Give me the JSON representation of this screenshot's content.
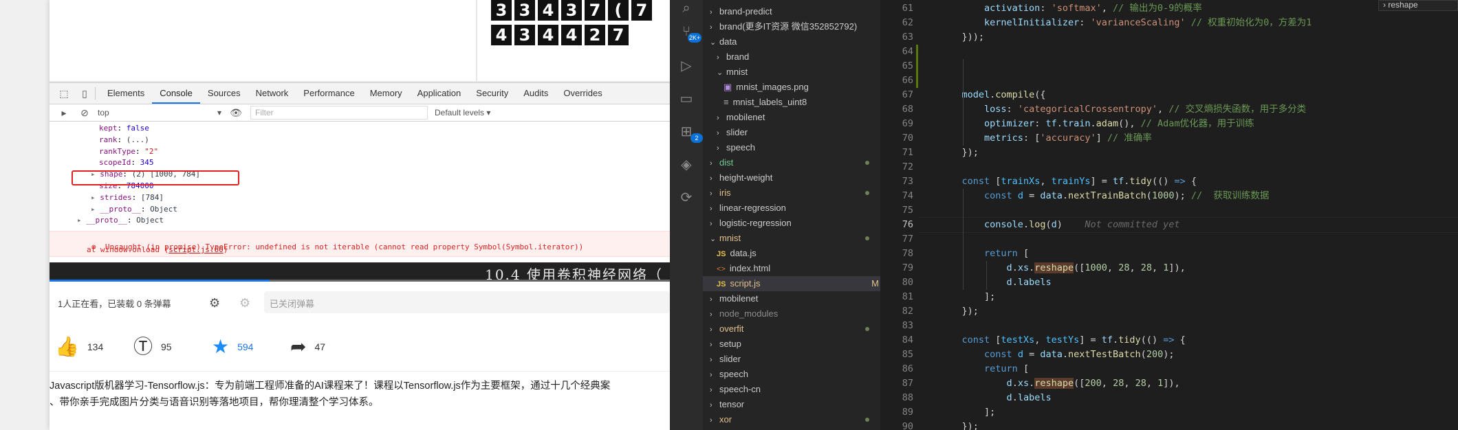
{
  "devtools": {
    "tabs": [
      "Elements",
      "Console",
      "Sources",
      "Network",
      "Performance",
      "Memory",
      "Application",
      "Security",
      "Audits",
      "Overrides"
    ],
    "active_tab": "Console",
    "context": "top",
    "filter_placeholder": "Filter",
    "levels": "Default levels ▾",
    "console_lines": [
      {
        "key": "kept",
        "value": "false",
        "kind": "num"
      },
      {
        "key": "rank",
        "value": "(...)",
        "kind": "obj"
      },
      {
        "key": "rankType",
        "value": "\"2\"",
        "kind": "str"
      },
      {
        "key": "scopeId",
        "value": "345",
        "kind": "num"
      },
      {
        "key": "shape",
        "value": "(2) [1000, 784]",
        "kind": "obj"
      },
      {
        "key": "size",
        "value": "784000",
        "kind": "num"
      },
      {
        "key": "strides",
        "value": "[784]",
        "kind": "obj"
      },
      {
        "key": "__proto__",
        "value": "Object",
        "kind": "obj"
      },
      {
        "key": "__proto__",
        "value": "Object",
        "kind": "obj"
      }
    ],
    "error_line1": "Uncaught (in promise) TypeError: undefined is not iterable (cannot read property Symbol(Symbol.iterator))",
    "error_line2_prefix": "at window.onload (",
    "error_link": "script.js:60",
    "error_line2_suffix": ")"
  },
  "video": {
    "title": "10.4 使用卷积神经网络（",
    "watching": "1人正在看，已装载 0 条弹幕",
    "danmaku_placeholder": "已关闭弹幕"
  },
  "actions": {
    "like": "134",
    "coin": "95",
    "favorite": "594",
    "share": "47"
  },
  "description": {
    "line1": "Javascript版机器学习-Tensorflow.js：专为前端工程师准备的AI课程来了！课程以Tensorflow.js作为主要框架，通过十几个经典案",
    "line2": "、带你亲手完成图片分类与语音识别等落地项目，帮你理清整个学习体系。"
  },
  "activity_badges": {
    "source_control": "2K+",
    "extensions": "2"
  },
  "explorer": {
    "items": [
      {
        "label": "brand-predict",
        "indent": 1,
        "open": false,
        "color": "#cccccc"
      },
      {
        "label": "brand(更多IT资源 微信352852792)",
        "indent": 1,
        "open": false,
        "color": "#cccccc"
      },
      {
        "label": "data",
        "indent": 1,
        "open": true,
        "color": "#cccccc"
      },
      {
        "label": "brand",
        "indent": 2,
        "open": false,
        "color": "#cccccc"
      },
      {
        "label": "mnist",
        "indent": 2,
        "open": true,
        "color": "#cccccc"
      },
      {
        "label": "mnist_images.png",
        "indent": 3,
        "file": "img",
        "color": "#cccccc"
      },
      {
        "label": "mnist_labels_uint8",
        "indent": 3,
        "file": "txt",
        "color": "#cccccc"
      },
      {
        "label": "mobilenet",
        "indent": 2,
        "open": false,
        "color": "#cccccc"
      },
      {
        "label": "slider",
        "indent": 2,
        "open": false,
        "color": "#cccccc"
      },
      {
        "label": "speech",
        "indent": 2,
        "open": false,
        "color": "#cccccc"
      },
      {
        "label": "dist",
        "indent": 1,
        "open": false,
        "color": "#73c991",
        "dot": true
      },
      {
        "label": "height-weight",
        "indent": 1,
        "open": false,
        "color": "#cccccc"
      },
      {
        "label": "iris",
        "indent": 1,
        "open": false,
        "color": "#e2c08d",
        "dot": true
      },
      {
        "label": "linear-regression",
        "indent": 1,
        "open": false,
        "color": "#cccccc"
      },
      {
        "label": "logistic-regression",
        "indent": 1,
        "open": false,
        "color": "#cccccc"
      },
      {
        "label": "mnist",
        "indent": 1,
        "open": true,
        "color": "#e2c08d",
        "dot": true
      },
      {
        "label": "data.js",
        "indent": 2,
        "file": "js",
        "color": "#cccccc"
      },
      {
        "label": "index.html",
        "indent": 2,
        "file": "html",
        "color": "#cccccc"
      },
      {
        "label": "script.js",
        "indent": 2,
        "file": "js",
        "color": "#e2c08d",
        "badge": "M",
        "selected": true
      },
      {
        "label": "mobilenet",
        "indent": 1,
        "open": false,
        "color": "#cccccc"
      },
      {
        "label": "node_modules",
        "indent": 1,
        "open": false,
        "color": "#8b8b8b"
      },
      {
        "label": "overfit",
        "indent": 1,
        "open": false,
        "color": "#e2c08d",
        "dot": true
      },
      {
        "label": "setup",
        "indent": 1,
        "open": false,
        "color": "#cccccc"
      },
      {
        "label": "slider",
        "indent": 1,
        "open": false,
        "color": "#cccccc"
      },
      {
        "label": "speech",
        "indent": 1,
        "open": false,
        "color": "#cccccc"
      },
      {
        "label": "speech-cn",
        "indent": 1,
        "open": false,
        "color": "#cccccc"
      },
      {
        "label": "tensor",
        "indent": 1,
        "open": false,
        "color": "#cccccc"
      },
      {
        "label": "xor",
        "indent": 1,
        "open": false,
        "color": "#e2c08d",
        "dot": true
      }
    ]
  },
  "editor": {
    "current_line": 76,
    "ghost_text": "Not committed yet",
    "breadcrumb_tag": "reshape",
    "lines": [
      {
        "n": 61,
        "html": "        <span class='c-prop'>activation</span>: <span class='c-str'>'softmax'</span>, <span class='c-cm'>// 输出为0-9的概率</span>"
      },
      {
        "n": 62,
        "html": "        <span class='c-prop'>kernelInitializer</span>: <span class='c-str'>'varianceScaling'</span> <span class='c-cm'>// 权重初始化为0，方差为1</span>"
      },
      {
        "n": 63,
        "html": "    }));"
      },
      {
        "n": 64,
        "html": ""
      },
      {
        "n": 65,
        "html": ""
      },
      {
        "n": 66,
        "html": ""
      },
      {
        "n": 67,
        "html": "    <span class='c-prop'>model</span>.<span class='c-fn'>compile</span>({"
      },
      {
        "n": 68,
        "html": "        <span class='c-prop'>loss</span>: <span class='c-str'>'categoricalCrossentropy'</span>, <span class='c-cm'>// 交叉熵损失函数，用于多分类</span>"
      },
      {
        "n": 69,
        "html": "        <span class='c-prop'>optimizer</span>: <span class='c-prop'>tf</span>.<span class='c-prop'>train</span>.<span class='c-fn'>adam</span>(), <span class='c-cm'>// Adam优化器，用于训练</span>"
      },
      {
        "n": 70,
        "html": "        <span class='c-prop'>metrics</span>: [<span class='c-str'>'accuracy'</span>] <span class='c-cm'>// 准确率</span>"
      },
      {
        "n": 71,
        "html": "    });"
      },
      {
        "n": 72,
        "html": ""
      },
      {
        "n": 73,
        "html": "    <span class='c-kw'>const</span> [<span class='c-var'>trainXs</span>, <span class='c-var'>trainYs</span>] = <span class='c-prop'>tf</span>.<span class='c-fn'>tidy</span>(() <span class='c-kw'>=&gt;</span> {"
      },
      {
        "n": 74,
        "html": "        <span class='c-kw'>const</span> <span class='c-var'>d</span> = <span class='c-prop'>data</span>.<span class='c-fn'>nextTrainBatch</span>(<span class='c-num'>1000</span>); <span class='c-cm'>//  获取训练数据</span>"
      },
      {
        "n": 75,
        "html": ""
      },
      {
        "n": 76,
        "html": "        <span class='c-prop'>console</span>.<span class='c-fn'>log</span>(<span class='c-prop'>d</span>)    <span class='ghost'>Not committed yet</span>"
      },
      {
        "n": 77,
        "html": ""
      },
      {
        "n": 78,
        "html": "        <span class='c-kw'>return</span> ["
      },
      {
        "n": 79,
        "html": "            <span class='c-prop'>d</span>.<span class='c-prop'>xs</span>.<span class='c-hl'>reshape</span>([<span class='c-num'>1000</span>, <span class='c-num'>28</span>, <span class='c-num'>28</span>, <span class='c-num'>1</span>]),"
      },
      {
        "n": 80,
        "html": "            <span class='c-prop'>d</span>.<span class='c-prop'>labels</span>"
      },
      {
        "n": 81,
        "html": "        ];"
      },
      {
        "n": 82,
        "html": "    });"
      },
      {
        "n": 83,
        "html": ""
      },
      {
        "n": 84,
        "html": "    <span class='c-kw'>const</span> [<span class='c-var'>testXs</span>, <span class='c-var'>testYs</span>] = <span class='c-prop'>tf</span>.<span class='c-fn'>tidy</span>(() <span class='c-kw'>=&gt;</span> {"
      },
      {
        "n": 85,
        "html": "        <span class='c-kw'>const</span> <span class='c-var'>d</span> = <span class='c-prop'>data</span>.<span class='c-fn'>nextTestBatch</span>(<span class='c-num'>200</span>);"
      },
      {
        "n": 86,
        "html": "        <span class='c-kw'>return</span> ["
      },
      {
        "n": 87,
        "html": "            <span class='c-prop'>d</span>.<span class='c-prop'>xs</span>.<span class='c-hl'>reshape</span>([<span class='c-num'>200</span>, <span class='c-num'>28</span>, <span class='c-num'>28</span>, <span class='c-num'>1</span>]),"
      },
      {
        "n": 88,
        "html": "            <span class='c-prop'>d</span>.<span class='c-prop'>labels</span>"
      },
      {
        "n": 89,
        "html": "        ];"
      },
      {
        "n": 90,
        "html": "    });"
      }
    ]
  },
  "mnist_digits": {
    "row1": [
      "3",
      "3",
      "4",
      "3",
      "7",
      "(",
      "7"
    ],
    "row2": [
      "4",
      "3",
      "4",
      "4",
      "2",
      "7"
    ]
  }
}
